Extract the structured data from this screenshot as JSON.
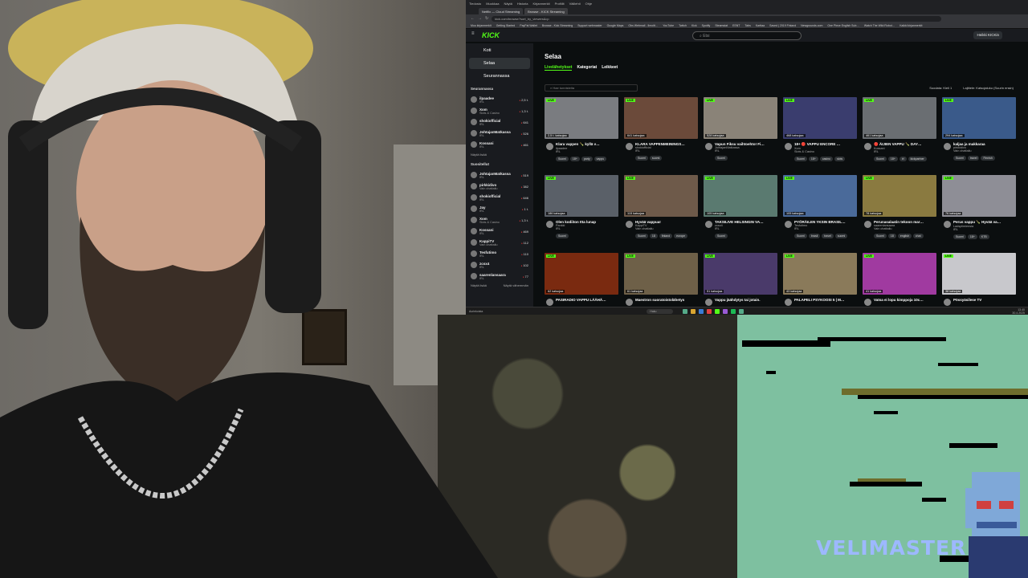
{
  "os_menu": [
    "Tiedosto",
    "Muokkaa",
    "Näytä",
    "Historia",
    "Kirjanmerkit",
    "Profiilit",
    "Välilehti",
    "Ohje"
  ],
  "browser": {
    "tabs": [
      "Netflix — Cloud Streaming",
      "Browse - KICK Streaming"
    ],
    "url": "kick.com/browse?sort_by_viewers&q=",
    "bookmarks": [
      "Muu kirjanmerkit",
      "Getting Started",
      "PayPal Wallet",
      "Browse - Kick Streaming",
      "Support webmaster",
      "Google Maps",
      "Obs Webmail - Ilmoitt…",
      "YouTube",
      "Twitch",
      "Kick",
      "Spotify",
      "Steamstat",
      "ESNT",
      "Tabs",
      "Karttaa",
      "Saved | 2019 Finland",
      "Newgrounds.com",
      "One Piece English Sub…",
      "Watch The Wild Robot…",
      "Kaikki kirjanmerkit"
    ]
  },
  "kick": {
    "logo": "KICK",
    "search_placeholder": "Etsi",
    "user_button": "Heikki KICKin",
    "nav": [
      {
        "label": "Koti"
      },
      {
        "label": "Selaa"
      },
      {
        "label": "Seurannassa"
      }
    ],
    "following_header": "Seurannassa",
    "following": [
      {
        "name": "ilpaadee",
        "cat": "IRL",
        "count": "2,5 t."
      },
      {
        "name": "Xom",
        "cat": "Slots & Casino",
        "count": "1,3 t."
      },
      {
        "name": "shokiofficial",
        "cat": "IRL",
        "count": "641"
      },
      {
        "name": "JohtajanMatkassa",
        "cat": "IRL",
        "count": "526"
      },
      {
        "name": "Kossani",
        "cat": "IRL",
        "count": "461"
      }
    ],
    "show_more": "Näytä lisää",
    "recommended_header": "Suositellut",
    "recommended": [
      {
        "name": "JohtajanMatkassa",
        "cat": "IRL",
        "count": "519"
      },
      {
        "name": "pirkkidivo",
        "cat": "Vain chattailu",
        "count": "382"
      },
      {
        "name": "shokiofficial",
        "cat": "IRL",
        "count": "646"
      },
      {
        "name": "Jay",
        "cat": "IRL",
        "count": "1 t."
      },
      {
        "name": "Xom",
        "cat": "Slots & Casino",
        "count": "1,3 t."
      },
      {
        "name": "Kossani",
        "cat": "IRL",
        "count": "469"
      },
      {
        "name": "KappiTV",
        "cat": "Vain chattailu",
        "count": "112"
      },
      {
        "name": "Tesfutimo",
        "cat": "IRL",
        "count": "110"
      },
      {
        "name": "zcsx4",
        "cat": "IRL",
        "count": "102"
      },
      {
        "name": "saarenlansaara",
        "cat": "IRL",
        "count": "77"
      }
    ],
    "bottom_left": "Näytä lisää",
    "bottom_right": "Näytä vähemmän",
    "page_title": "Selaa",
    "subtabs": [
      "Livelähetykset",
      "Kategoriat",
      "Leikkeet"
    ],
    "filter_placeholder": "Hae tunnisteita",
    "sort": {
      "lang_label": "Suodata:",
      "lang": "Kieli 1",
      "sort_label": "Lajittele:",
      "sort_value": "Katsojaluku (Suurin ensin)"
    },
    "cards": [
      {
        "viewers": "2,5 t. katsojaa",
        "title": "Klara vappen 🍾 kyllä v…",
        "channel": "ilpaadee",
        "cat": "IRL",
        "tags": [
          "Suomi",
          "18+",
          "party",
          "vappu"
        ],
        "color": "#7a7c80"
      },
      {
        "viewers": "641 katsojaa",
        "title": "KLARA VAPPENMEININGS…",
        "channel": "shokiofficial",
        "cat": "IRL",
        "tags": [
          "Suomi",
          "suomi"
        ],
        "color": "#6b4a3a"
      },
      {
        "viewers": "528 katsojaa",
        "title": "Vapun Fiksu vaihtoehto! Fi…",
        "channel": "JohtajanMatkassa",
        "cat": "IRL",
        "tags": [
          "Suomi"
        ],
        "color": "#8a8378"
      },
      {
        "viewers": "468 katsojaa",
        "title": "18+ 🔴 VAPPU ENCORE …",
        "channel": "Xom",
        "cat": "Slots & Casino",
        "tags": [
          "Suomi",
          "18+",
          "casino",
          "slots"
        ],
        "color": "#3a3d6e"
      },
      {
        "viewers": "461 katsojaa",
        "title": "🔴 ÄIJIEN VAPPU 🍾 DAY…",
        "channel": "Kossani",
        "cat": "IRL",
        "tags": [
          "Suomi",
          "18+",
          "irl",
          "kickpartner"
        ],
        "color": "#6a6e72"
      },
      {
        "viewers": "294 katsojaa",
        "title": "kaljaa ja makkaraa",
        "channel": "pirkkidivo",
        "cat": "Vain chattailu",
        "tags": [
          "Suomi",
          "travel",
          "Finnish"
        ],
        "color": "#3a5a8a"
      },
      {
        "viewers": "186 katsojaa",
        "title": "Olen kodiiton Itta lunap",
        "channel": "Pankki",
        "cat": "IRL",
        "tags": [
          "Suomi"
        ],
        "color": "#5a6068"
      },
      {
        "viewers": "115 katsojaa",
        "title": "Hyvää vappua!",
        "channel": "KappiTV",
        "cat": "Vain chattailu",
        "tags": [
          "Suomi",
          "18",
          "finland",
          "europe"
        ],
        "color": "#6e5a4a"
      },
      {
        "viewers": "105 katsojaa",
        "title": "TAKSILIVE HELSINGIN VA…",
        "channel": "zcsx4",
        "cat": "IRL",
        "tags": [
          "Suomi"
        ],
        "color": "#5a7a70"
      },
      {
        "viewers": "105 katsojaa",
        "title": "PYÖRÄILEN YKSIN BRASIL…",
        "channel": "Tesfutimo",
        "cat": "IRL",
        "tags": [
          "Suomi",
          "brasil",
          "travel",
          "suomi"
        ],
        "color": "#4a6a9a"
      },
      {
        "viewers": "78 katsojaa",
        "title": "Perunasalaatin tekoon mar…",
        "channel": "saarenlansaara",
        "cat": "Vain chattailu",
        "tags": [
          "Suomi",
          "18",
          "english",
          "chat"
        ],
        "color": "#8a7a40"
      },
      {
        "viewers": "76 katsojaa",
        "title": "Perus vappu 🍾 Hyvää va…",
        "channel": "Ladsplimiensia",
        "cat": "IRL",
        "tags": [
          "Suomi",
          "18+",
          "KTB"
        ],
        "color": "#8e8e96"
      },
      {
        "viewers": "62 katsojaa",
        "title": "PASIRADIO VAPPU LÄÄHÄ…",
        "channel": "",
        "cat": "",
        "tags": [],
        "color": "#7a2a10"
      },
      {
        "viewers": "61 katsojaa",
        "title": "Maestron suoratoistolähetys",
        "channel": "",
        "cat": "",
        "tags": [],
        "color": "#6e6048"
      },
      {
        "viewers": "51 katsojaa",
        "title": "Vappu jäähdytys tai jotain.",
        "channel": "",
        "cat": "",
        "tags": [],
        "color": "#4a3a6a"
      },
      {
        "viewers": "43 katsojaa",
        "title": "PALAPELI PSYKOOSI 5 | M…",
        "channel": "",
        "cat": "",
        "tags": [],
        "color": "#8a7a5a"
      },
      {
        "viewers": "41 katsojaa",
        "title": "Vatsa ei lopu kimppoja 10c…",
        "channel": "",
        "cat": "",
        "tags": [],
        "color": "#a03aa0"
      },
      {
        "viewers": "38 katsojaa",
        "title": "Pössyäsilese TV",
        "channel": "",
        "cat": "",
        "tags": [],
        "color": "#c8c8cc"
      }
    ],
    "live_badge": "LIVE"
  },
  "taskbar": {
    "weather": "Aurinkoista",
    "search": "Haku",
    "time": "13.40",
    "date": "30.4.2025"
  },
  "overlay": {
    "brand": "VELIMASTER"
  }
}
